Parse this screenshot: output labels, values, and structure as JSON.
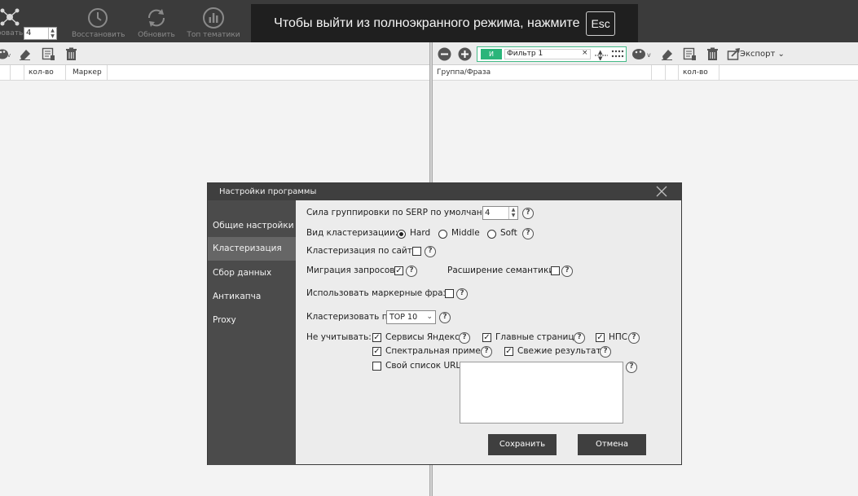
{
  "toolbar": {
    "spin_value": "4",
    "buttons": [
      {
        "label": "ровать",
        "icon": "cluster-icon"
      },
      {
        "label": "Восстановить",
        "icon": "history-icon"
      },
      {
        "label": "Обновить",
        "icon": "refresh-icon"
      },
      {
        "label": "Топ тематики",
        "icon": "chart-icon"
      }
    ]
  },
  "fullscreen_banner": {
    "text": "Чтобы выйти из полноэкранного режима, нажмите",
    "key": "Esc"
  },
  "left_panel": {
    "columns": [
      "кол-во",
      "Маркер"
    ]
  },
  "right_panel": {
    "filter_tag": "И",
    "filter_text": "Фильтр 1",
    "filter_clear": "×",
    "export_label": "Экспорт",
    "columns": [
      "Группа/Фраза",
      "кол-во"
    ]
  },
  "modal": {
    "title": "Настройки программы",
    "sidebar": [
      {
        "label": "Общие настройки",
        "active": false
      },
      {
        "label": "Кластеризация",
        "active": true
      },
      {
        "label": "Сбор данных",
        "active": false
      },
      {
        "label": "Антикапча",
        "active": false
      },
      {
        "label": "Proxy",
        "active": false
      }
    ],
    "serp_strength_label": "Сила группировки по SERP по умолчанию:",
    "serp_strength_value": "4",
    "cluster_type_label": "Вид кластеризации:",
    "cluster_type_options": [
      "Hard",
      "Middle",
      "Soft"
    ],
    "cluster_type_selected": "Hard",
    "by_site_label": "Кластеризация по сайту",
    "by_site_checked": false,
    "migration_label": "Миграция запросов",
    "migration_checked": true,
    "semantics_label": "Расширение семантики",
    "semantics_checked": false,
    "marker_label": "Использовать маркерные фразы",
    "marker_checked": false,
    "cluster_by_label": "Кластеризовать по",
    "cluster_by_value": "TOP 10",
    "ignore_label": "Не учитывать:",
    "ignore_yandex": {
      "label": "Сервисы Яндекса",
      "checked": true
    },
    "ignore_main": {
      "label": "Главные страницы",
      "checked": true
    },
    "ignore_nps": {
      "label": "НПС",
      "checked": true
    },
    "ignore_spectral": {
      "label": "Спектральная примесь",
      "checked": true
    },
    "ignore_fresh": {
      "label": "Свежие результаты",
      "checked": true
    },
    "ignore_url": {
      "label": "Свой список URL",
      "checked": false
    },
    "url_list_value": "",
    "save_label": "Сохранить",
    "cancel_label": "Отмена"
  },
  "colors": {
    "toolbar_bg": "#3b3b3b",
    "sidebar_bg": "#4b4b4b",
    "sidebar_active": "#666666",
    "accent_green": "#2bb57a",
    "button_bg": "#3f3f3f"
  }
}
